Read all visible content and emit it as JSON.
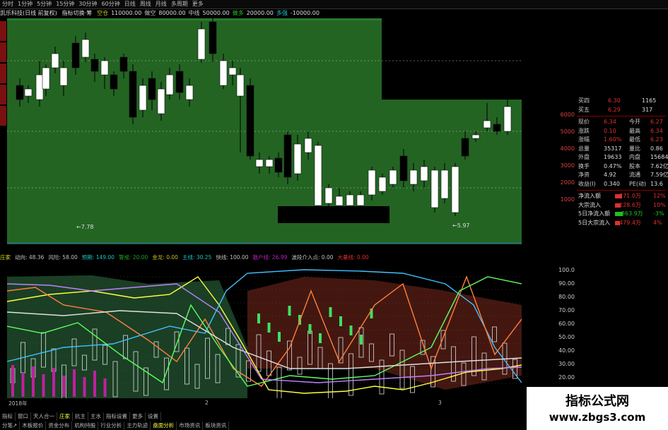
{
  "topbar": {
    "periods": [
      "分时",
      "1分钟",
      "5分钟",
      "15分钟",
      "30分钟",
      "60分钟",
      "日线",
      "周线",
      "月线",
      "多周期",
      "更多"
    ]
  },
  "infobar": {
    "stock": "凯乐科技(日线 前复权)",
    "indicator": "指标切换·筹",
    "params": [
      {
        "label": "空仓",
        "value": "110000.00",
        "color": "#c8c820"
      },
      {
        "label": "做空",
        "value": "80000.00",
        "color": "#c8c8c8"
      },
      {
        "label": "中线",
        "value": "50000.00",
        "color": "#c8c8c8"
      },
      {
        "label": "做多",
        "value": "20000.00",
        "color": "#20c820"
      },
      {
        "label": "多强",
        "value": "-10000.00",
        "color": "#20c8c8"
      }
    ]
  },
  "mainchart": {
    "bg": "#1f5f1f",
    "low_label": "←7.78",
    "low_label2": "←5.97"
  },
  "scale1": [
    "6000",
    "5000",
    "4000",
    "3000",
    "2000",
    "1000"
  ],
  "quote": {
    "rows": [
      {
        "l": "买四",
        "v": "6.30",
        "r": "1165"
      },
      {
        "l": "买五",
        "v": "6.29",
        "r": "317"
      }
    ],
    "stats": [
      {
        "l": "现价",
        "v": "6.34",
        "l2": "今开",
        "v2": "6.27"
      },
      {
        "l": "涨跌",
        "v": "0.10",
        "l2": "最高",
        "v2": "6.34"
      },
      {
        "l": "涨幅",
        "v": "1.60%",
        "l2": "最低",
        "v2": "6.23"
      },
      {
        "l": "总量",
        "v": "35317",
        "l2": "量比",
        "v2": "0.86"
      },
      {
        "l": "外盘",
        "v": "19633",
        "l2": "内盘",
        "v2": "15684"
      },
      {
        "l": "换手",
        "v": "0.47%",
        "l2": "股本",
        "v2": "7.62亿"
      },
      {
        "l": "净资",
        "v": "4.92",
        "l2": "流通",
        "v2": "7.59亿"
      },
      {
        "l": "收益(I)",
        "v": "0.340",
        "l2": "PE(动)",
        "v2": "13.6"
      }
    ],
    "flows": [
      {
        "l": "净流入额",
        "v": "271.0万",
        "p": "12%",
        "c": "#e03030",
        "bar": 0.7
      },
      {
        "l": "大宗流入",
        "v": "228.6万",
        "p": "10%",
        "c": "#e03030",
        "bar": 0.6
      },
      {
        "l": "5日净流入额",
        "v": "-363.9万",
        "p": "-3%",
        "c": "#20c020",
        "bar": 0.75
      },
      {
        "l": "5日大宗流入",
        "v": "479.4万",
        "p": "4%",
        "c": "#e03030",
        "bar": 0.5
      }
    ]
  },
  "indbar": {
    "items": [
      {
        "t": "庄家",
        "c": "#dddd20"
      },
      {
        "t": "动向: 48.36",
        "c": "#c0c0c0"
      },
      {
        "t": "风险: 58.00",
        "c": "#c0c0c0"
      },
      {
        "t": "预期: 149.00",
        "c": "#20c0c0"
      },
      {
        "t": "警戒: 20.00",
        "c": "#20a020"
      },
      {
        "t": "金龙: 0.00",
        "c": "#c0c020"
      },
      {
        "t": "主线: 30.25",
        "c": "#20c0c0"
      },
      {
        "t": "快线: 100.00",
        "c": "#c0c0c0"
      },
      {
        "t": "散户线: 26.99",
        "c": "#c020c0"
      },
      {
        "t": "波段介入点: 0.00",
        "c": "#c0c0c0"
      },
      {
        "t": "大量线: 0.00",
        "c": "#e03030"
      }
    ]
  },
  "scale2": [
    "100.0",
    "90.00",
    "80.00",
    "70.00",
    "60.00",
    "50.00",
    "40.00",
    "30.00",
    "20.00",
    "10.00"
  ],
  "dateaxis": [
    "2018年",
    "2",
    "3"
  ],
  "tabs1": [
    "指标",
    "窗口",
    "天人合一",
    "庄家",
    "抗主",
    "主水",
    "指标设置",
    "更多",
    "设置"
  ],
  "tabs2": [
    "分笔↗",
    "木板报价",
    "资金分布",
    "机构持股",
    "行业分析",
    "主力轨迹",
    "盘面分析",
    "市场资讯",
    "板块资讯"
  ],
  "watermark": {
    "line1": "指标公式网",
    "line2": "www.zbgs3.com"
  }
}
